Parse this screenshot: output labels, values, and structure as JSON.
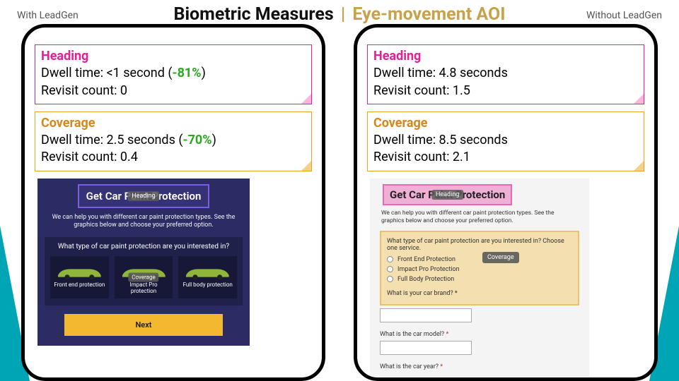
{
  "title_a": "Biometric Measures",
  "title_sep": "|",
  "title_b": "Eye-movement AOI",
  "label_left": "With LeadGen",
  "label_right": "Without LeadGen",
  "left": {
    "heading": {
      "label": "Heading",
      "dwell_pre": "Dwell time: <1 second (",
      "dwell_delta": "-81%",
      "dwell_post": ")",
      "revisit": "Revisit count: 0"
    },
    "coverage": {
      "label": "Coverage",
      "dwell_pre": "Dwell time: 2.5 seconds (",
      "dwell_delta": "-70%",
      "dwell_post": ")",
      "revisit": "Revisit count: 0.4"
    },
    "preview": {
      "title": "Get Car Paint Protection",
      "aoi_heading": "Heading",
      "sub": "We can help you with different car paint protection types. See the graphics below and choose your preferred option.",
      "question": "What type of car paint protection are you interested in?",
      "aoi_coverage": "Coverage",
      "opt1": "Front end protection",
      "opt2": "Impact Pro protection",
      "opt3": "Full body protection",
      "next": "Next"
    }
  },
  "right": {
    "heading": {
      "label": "Heading",
      "dwell": "Dwell time: 4.8 seconds",
      "revisit": "Revisit count: 1.5"
    },
    "coverage": {
      "label": "Coverage",
      "dwell": "Dwell time: 8.5 seconds",
      "revisit": "Revisit count: 2.1"
    },
    "preview": {
      "title": "Get Car Paint Protection",
      "aoi_heading": "Heading",
      "sub": "We can help you with different car paint protection types. See the graphics below and choose your preferred option.",
      "question": "What type of car paint protection are you interested in? Choose one service.",
      "opt1": "Front End Protection",
      "opt2": "Impact Pro Protection",
      "opt3": "Full Body Protection",
      "aoi_coverage": "Coverage",
      "q2": "What is your car brand?",
      "q3": "What is the car model?",
      "q4": "What is the car year?",
      "req": "*"
    }
  }
}
